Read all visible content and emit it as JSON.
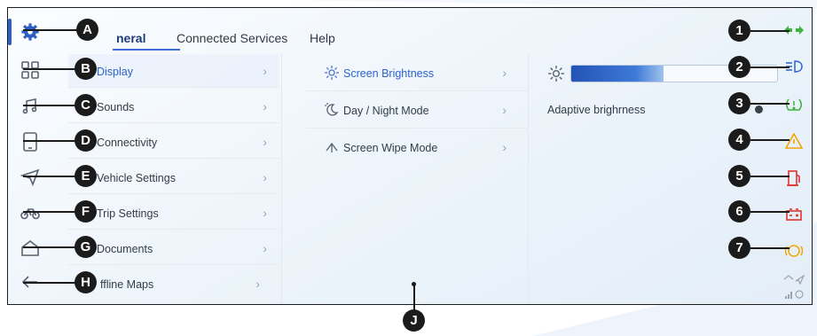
{
  "tabs": [
    {
      "label": "General",
      "visible_text": "neral",
      "active": true
    },
    {
      "label": "Connected Services",
      "active": false
    },
    {
      "label": "Help",
      "active": false
    }
  ],
  "menu": {
    "items": [
      {
        "label": "Display",
        "active": true
      },
      {
        "label": "Sounds"
      },
      {
        "label": "Connectivity"
      },
      {
        "label": "Vehicle Settings"
      },
      {
        "label": "Trip Settings"
      },
      {
        "label": "Documents"
      },
      {
        "label": "ffline Maps"
      }
    ],
    "chevron": "›"
  },
  "submenu": {
    "items": [
      {
        "label": "Screen Brightness",
        "active": true,
        "icon": "sun-icon"
      },
      {
        "label": "Day / Night Mode",
        "icon": "day-night-icon"
      },
      {
        "label": "Screen Wipe Mode",
        "icon": "wipe-icon"
      }
    ]
  },
  "detail": {
    "brightness_level": 0.45,
    "adaptive_label": "Adaptive brighrness"
  },
  "left_rail_icons": [
    "gear-icon",
    "grid-icon",
    "music-note-icon",
    "phone-icon",
    "navigation-arrow-icon",
    "motorcycle-icon",
    "home-icon",
    "back-arrow-icon"
  ],
  "right_rail_icons": [
    "turn-signal-icon",
    "headlight-icon",
    "tire-pressure-icon",
    "warning-triangle-icon",
    "fuel-icon",
    "battery-icon",
    "abs-icon",
    "signal-icon",
    "navigation-icon"
  ],
  "callouts": {
    "letters": [
      "A",
      "B",
      "C",
      "D",
      "E",
      "F",
      "G",
      "H",
      "J"
    ],
    "numbers": [
      "1",
      "2",
      "3",
      "4",
      "5",
      "6",
      "7"
    ]
  },
  "colors": {
    "accent": "#2b63cf",
    "callout": "#1b1b1b",
    "turn_signal": "#3fb23f",
    "warning": "#f2a500",
    "alert_red": "#e0322c",
    "headlight_blue": "#2b63cf"
  }
}
